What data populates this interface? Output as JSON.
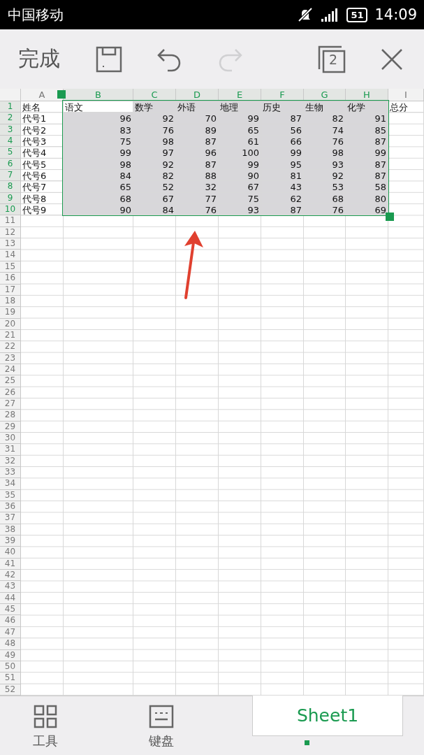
{
  "status_bar": {
    "carrier": "中国移动",
    "battery": "51",
    "time": "14:09"
  },
  "toolbar": {
    "done": "完成",
    "redo_disabled": true,
    "window_count": "2"
  },
  "sheet": {
    "columns": [
      {
        "label": "A",
        "selected": false
      },
      {
        "label": "B",
        "selected": true
      },
      {
        "label": "C",
        "selected": true
      },
      {
        "label": "D",
        "selected": true
      },
      {
        "label": "E",
        "selected": true
      },
      {
        "label": "F",
        "selected": true
      },
      {
        "label": "G",
        "selected": true
      },
      {
        "label": "H",
        "selected": true
      },
      {
        "label": "I",
        "selected": false
      }
    ],
    "rows": [
      {
        "number": "1",
        "selected": true,
        "kind": "header",
        "cells": [
          {
            "text": "姓名",
            "active": false
          },
          {
            "text": "语文",
            "active": true
          },
          {
            "text": "数学",
            "active": false
          },
          {
            "text": "外语",
            "active": false
          },
          {
            "text": "地理",
            "active": false
          },
          {
            "text": "历史",
            "active": false
          },
          {
            "text": "生物",
            "active": false
          },
          {
            "text": "化学",
            "active": false
          },
          {
            "text": "总分",
            "active": false
          }
        ]
      },
      {
        "number": "2",
        "selected": true,
        "kind": "data",
        "cells": [
          {
            "text": "代号1",
            "active": false
          },
          {
            "text": "96",
            "active": false
          },
          {
            "text": "92",
            "active": false
          },
          {
            "text": "70",
            "active": false
          },
          {
            "text": "99",
            "active": false
          },
          {
            "text": "87",
            "active": false
          },
          {
            "text": "82",
            "active": false
          },
          {
            "text": "91",
            "active": false
          }
        ]
      },
      {
        "number": "3",
        "selected": true,
        "kind": "data",
        "cells": [
          {
            "text": "代号2",
            "active": false
          },
          {
            "text": "83",
            "active": false
          },
          {
            "text": "76",
            "active": false
          },
          {
            "text": "89",
            "active": false
          },
          {
            "text": "65",
            "active": false
          },
          {
            "text": "56",
            "active": false
          },
          {
            "text": "74",
            "active": false
          },
          {
            "text": "85",
            "active": false
          }
        ]
      },
      {
        "number": "4",
        "selected": true,
        "kind": "data",
        "cells": [
          {
            "text": "代号3",
            "active": false
          },
          {
            "text": "75",
            "active": false
          },
          {
            "text": "98",
            "active": false
          },
          {
            "text": "87",
            "active": false
          },
          {
            "text": "61",
            "active": false
          },
          {
            "text": "66",
            "active": false
          },
          {
            "text": "76",
            "active": false
          },
          {
            "text": "87",
            "active": false
          }
        ]
      },
      {
        "number": "5",
        "selected": true,
        "kind": "data",
        "cells": [
          {
            "text": "代号4",
            "active": false
          },
          {
            "text": "99",
            "active": false
          },
          {
            "text": "97",
            "active": false
          },
          {
            "text": "96",
            "active": false
          },
          {
            "text": "100",
            "active": false
          },
          {
            "text": "99",
            "active": false
          },
          {
            "text": "98",
            "active": false
          },
          {
            "text": "99",
            "active": false
          }
        ]
      },
      {
        "number": "6",
        "selected": true,
        "kind": "data",
        "cells": [
          {
            "text": "代号5",
            "active": false
          },
          {
            "text": "98",
            "active": false
          },
          {
            "text": "92",
            "active": false
          },
          {
            "text": "87",
            "active": false
          },
          {
            "text": "99",
            "active": false
          },
          {
            "text": "95",
            "active": false
          },
          {
            "text": "93",
            "active": false
          },
          {
            "text": "87",
            "active": false
          }
        ]
      },
      {
        "number": "7",
        "selected": true,
        "kind": "data",
        "cells": [
          {
            "text": "代号6",
            "active": false
          },
          {
            "text": "84",
            "active": false
          },
          {
            "text": "82",
            "active": false
          },
          {
            "text": "88",
            "active": false
          },
          {
            "text": "90",
            "active": false
          },
          {
            "text": "81",
            "active": false
          },
          {
            "text": "92",
            "active": false
          },
          {
            "text": "87",
            "active": false
          }
        ]
      },
      {
        "number": "8",
        "selected": true,
        "kind": "data",
        "cells": [
          {
            "text": "代号7",
            "active": false
          },
          {
            "text": "65",
            "active": false
          },
          {
            "text": "52",
            "active": false
          },
          {
            "text": "32",
            "active": false
          },
          {
            "text": "67",
            "active": false
          },
          {
            "text": "43",
            "active": false
          },
          {
            "text": "53",
            "active": false
          },
          {
            "text": "58",
            "active": false
          }
        ]
      },
      {
        "number": "9",
        "selected": true,
        "kind": "data",
        "cells": [
          {
            "text": "代号8",
            "active": false
          },
          {
            "text": "68",
            "active": false
          },
          {
            "text": "67",
            "active": false
          },
          {
            "text": "77",
            "active": false
          },
          {
            "text": "75",
            "active": false
          },
          {
            "text": "62",
            "active": false
          },
          {
            "text": "68",
            "active": false
          },
          {
            "text": "80",
            "active": false
          }
        ]
      },
      {
        "number": "10",
        "selected": true,
        "kind": "data",
        "cells": [
          {
            "text": "代号9",
            "active": false
          },
          {
            "text": "90",
            "active": false
          },
          {
            "text": "84",
            "active": false
          },
          {
            "text": "76",
            "active": false
          },
          {
            "text": "93",
            "active": false
          },
          {
            "text": "87",
            "active": false
          },
          {
            "text": "76",
            "active": false
          },
          {
            "text": "69",
            "active": false
          }
        ]
      },
      {
        "number": "11",
        "selected": false,
        "kind": "empty"
      },
      {
        "number": "12",
        "selected": false,
        "kind": "empty"
      },
      {
        "number": "13",
        "selected": false,
        "kind": "empty"
      },
      {
        "number": "14",
        "selected": false,
        "kind": "empty"
      },
      {
        "number": "15",
        "selected": false,
        "kind": "empty"
      },
      {
        "number": "16",
        "selected": false,
        "kind": "empty"
      },
      {
        "number": "17",
        "selected": false,
        "kind": "empty"
      },
      {
        "number": "18",
        "selected": false,
        "kind": "empty"
      },
      {
        "number": "19",
        "selected": false,
        "kind": "empty"
      },
      {
        "number": "20",
        "selected": false,
        "kind": "empty"
      },
      {
        "number": "21",
        "selected": false,
        "kind": "empty"
      },
      {
        "number": "22",
        "selected": false,
        "kind": "empty"
      },
      {
        "number": "23",
        "selected": false,
        "kind": "empty"
      },
      {
        "number": "24",
        "selected": false,
        "kind": "empty"
      },
      {
        "number": "25",
        "selected": false,
        "kind": "empty"
      },
      {
        "number": "26",
        "selected": false,
        "kind": "empty"
      },
      {
        "number": "27",
        "selected": false,
        "kind": "empty"
      },
      {
        "number": "28",
        "selected": false,
        "kind": "empty"
      },
      {
        "number": "29",
        "selected": false,
        "kind": "empty"
      },
      {
        "number": "30",
        "selected": false,
        "kind": "empty"
      },
      {
        "number": "31",
        "selected": false,
        "kind": "empty"
      },
      {
        "number": "32",
        "selected": false,
        "kind": "empty"
      },
      {
        "number": "33",
        "selected": false,
        "kind": "empty"
      },
      {
        "number": "34",
        "selected": false,
        "kind": "empty"
      },
      {
        "number": "35",
        "selected": false,
        "kind": "empty"
      },
      {
        "number": "36",
        "selected": false,
        "kind": "empty"
      },
      {
        "number": "37",
        "selected": false,
        "kind": "empty"
      },
      {
        "number": "38",
        "selected": false,
        "kind": "empty"
      },
      {
        "number": "39",
        "selected": false,
        "kind": "empty"
      },
      {
        "number": "40",
        "selected": false,
        "kind": "empty"
      },
      {
        "number": "41",
        "selected": false,
        "kind": "empty"
      },
      {
        "number": "42",
        "selected": false,
        "kind": "empty"
      },
      {
        "number": "43",
        "selected": false,
        "kind": "empty"
      },
      {
        "number": "44",
        "selected": false,
        "kind": "empty"
      },
      {
        "number": "45",
        "selected": false,
        "kind": "empty"
      },
      {
        "number": "46",
        "selected": false,
        "kind": "empty"
      },
      {
        "number": "47",
        "selected": false,
        "kind": "empty"
      },
      {
        "number": "48",
        "selected": false,
        "kind": "empty"
      },
      {
        "number": "49",
        "selected": false,
        "kind": "empty"
      },
      {
        "number": "50",
        "selected": false,
        "kind": "empty"
      },
      {
        "number": "51",
        "selected": false,
        "kind": "empty"
      },
      {
        "number": "52",
        "selected": false,
        "kind": "empty"
      }
    ]
  },
  "bottom_bar": {
    "tools": "工具",
    "keyboard": "键盘",
    "sheet_tabs": [
      {
        "label": "Sheet1",
        "selected": true
      }
    ]
  }
}
